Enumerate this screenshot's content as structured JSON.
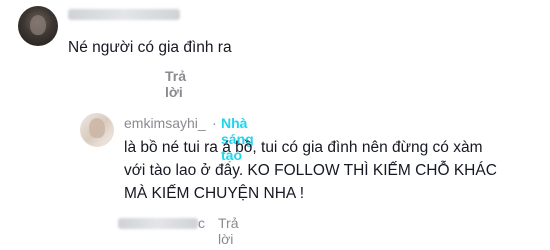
{
  "comment": {
    "text": "Né người có gia đình ra",
    "reply_label": "Trả lời"
  },
  "reply": {
    "username": "emkimsayhi_",
    "separator": "·",
    "badge": "Nhà sáng tạo",
    "lines": [
      "là bồ né tui ra á bồ, tui có gia đình nên đừng có xàm",
      "với tào lao ở đây. KO FOLLOW THÌ KIẾM CHỖ KHÁC",
      "MÀ KIẾM CHUYỆN NHA !"
    ],
    "reply_label": "Trả lời",
    "name_tail": "c"
  },
  "colors": {
    "text": "#161823",
    "muted": "#8a8b91",
    "creator_badge": "#20d5ec"
  }
}
